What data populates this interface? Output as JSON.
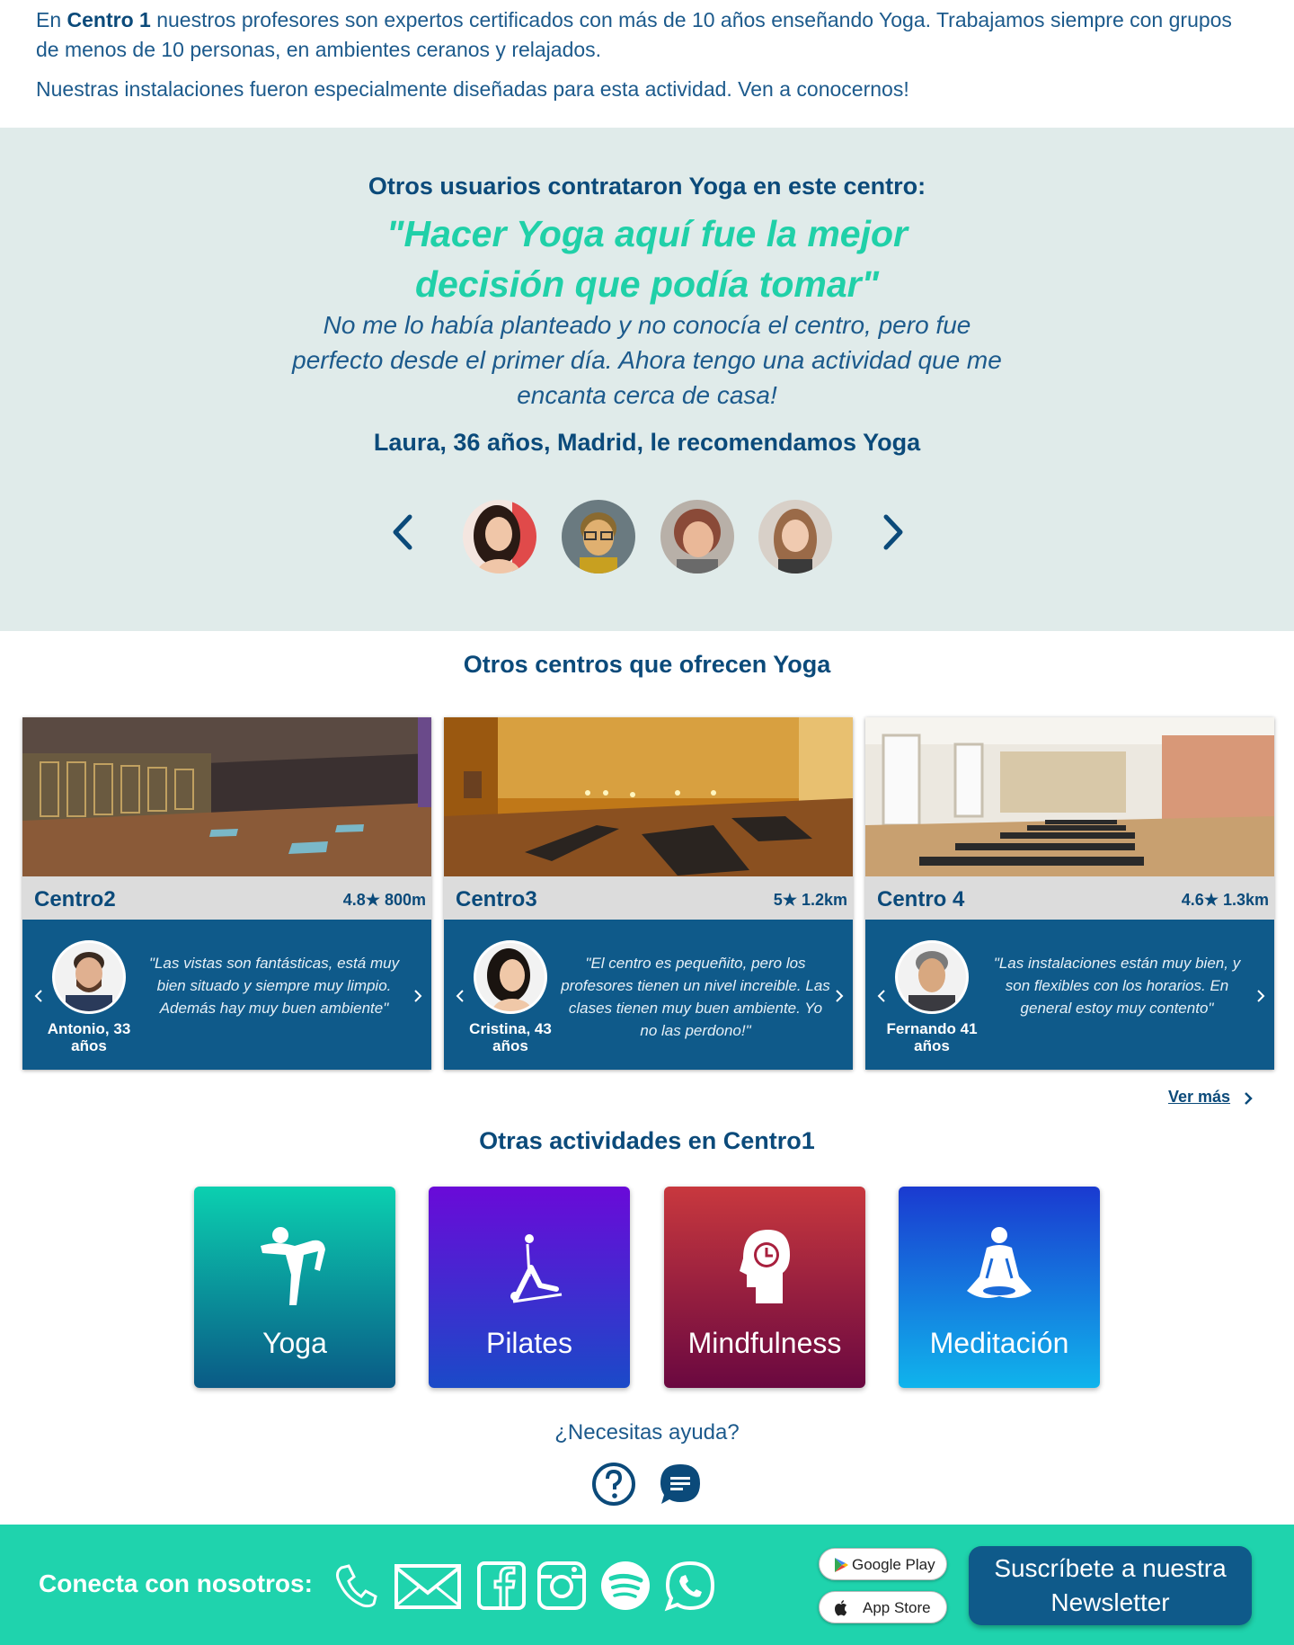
{
  "intro": {
    "p1_before": "En ",
    "p1_bold": "Centro 1",
    "p1_after": " nuestros profesores son expertos certificados con más de 10 años enseñando Yoga. Trabajamos siempre con grupos de menos de 10 personas, en ambientes ceranos y relajados.",
    "p2": "Nuestras instalaciones fueron especialmente diseñadas para esta actividad. Ven a conocernos!"
  },
  "testimonial": {
    "heading": "Otros usuarios contrataron Yoga en este centro:",
    "quote": "\"Hacer Yoga aquí fue la mejor decisión que podía tomar\"",
    "body": "No me lo había planteado y no conocía el centro, pero fue perfecto desde el primer día. Ahora tengo una actividad que me encanta cerca de casa!",
    "author": "Laura, 36 años, Madrid, le recomendamos Yoga",
    "prev_icon": "chevron-left-icon",
    "next_icon": "chevron-right-icon"
  },
  "centers": {
    "title": "Otros centros que ofrecen Yoga",
    "items": [
      {
        "name": "Centro2",
        "rating": "4.8",
        "distance": "800m",
        "person": "Antonio, 33 años",
        "quote": "\"Las vistas son fantásticas, está muy bien situado y siempre muy limpio. Además hay muy buen ambiente\""
      },
      {
        "name": "Centro3",
        "rating": "5",
        "distance": "1.2km",
        "person": "Cristina, 43 años",
        "quote": "\"El centro es pequeñito, pero los profesores tienen un nivel increible. Las clases tienen muy buen ambiente. Yo no las perdono!\""
      },
      {
        "name": "Centro 4",
        "rating": "4.6",
        "distance": "1.3km",
        "person": "Fernando 41 años",
        "quote": "\"Las instalaciones están muy bien, y son flexibles con los horarios. En general estoy muy contento\""
      }
    ],
    "ver_mas": "Ver más"
  },
  "activities": {
    "title": "Otras actividades en Centro1",
    "items": [
      {
        "label": "Yoga",
        "icon": "yoga-pose-icon"
      },
      {
        "label": "Pilates",
        "icon": "pilates-icon"
      },
      {
        "label": "Mindfulness",
        "icon": "mind-clock-icon"
      },
      {
        "label": "Meditación",
        "icon": "meditation-icon"
      }
    ]
  },
  "help": {
    "text": "¿Necesitas ayuda?"
  },
  "footer": {
    "label": "Conecta con nosotros:",
    "google_play": "Google Play",
    "app_store": "App Store",
    "newsletter_line1": "Suscríbete a nuestra",
    "newsletter_line2": "Newsletter"
  },
  "colors": {
    "primary": "#0b4a7a",
    "accent": "#20d0a8",
    "testimonial_bg": "#e0ebea",
    "card_body": "#0f5a8a",
    "footer": "#1fd3ad"
  }
}
